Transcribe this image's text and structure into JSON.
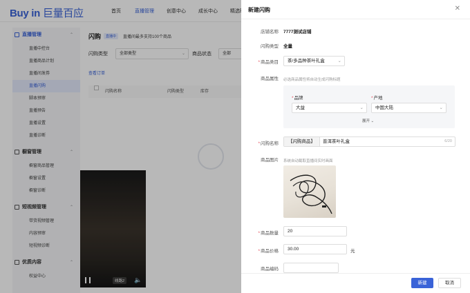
{
  "brand": {
    "logo_latin": "Buy in",
    "logo_cn": "巨量百应"
  },
  "topnav": [
    "首页",
    "直播管理",
    "创意中心",
    "成长中心",
    "精选联盟"
  ],
  "sidebar": {
    "groups": [
      {
        "label": "直播管理",
        "chevron": "⌃",
        "items": [
          "直播中控台",
          "直播商品计划",
          "直播间发券",
          "直播闪购",
          "脚本预审",
          "直播预告",
          "直播设置",
          "直播诊断"
        ]
      },
      {
        "label": "橱窗管理",
        "chevron": "⌃",
        "items": [
          "橱窗商品管理",
          "橱窗设置",
          "橱窗诊断"
        ]
      },
      {
        "label": "短视频管理",
        "chevron": "⌃",
        "items": [
          "带货视频管理",
          "内容预审",
          "短视频诊断"
        ]
      },
      {
        "label": "优质内容",
        "chevron": "⌃",
        "items": [
          "权益中心"
        ]
      }
    ]
  },
  "page": {
    "title": "闪购",
    "badge": "直播中",
    "tip": "直播间最多支持100个商品",
    "filter_type_label": "闪购类型",
    "filter_type_value": "全部类型",
    "filter_status_label": "商品状态",
    "filter_status_value": "全部",
    "orders_link": "查看订单",
    "columns": [
      "闪购名称",
      "闪购类型",
      "库存"
    ]
  },
  "video": {
    "line_label": "线路2"
  },
  "drawer": {
    "title": "新建闪购",
    "shop_label": "店铺名称",
    "shop_value": "7777测试店铺",
    "type_label": "闪购类型",
    "type_value": "全量",
    "category_label": "商品类目",
    "category_value": "茶/多品种茶叶礼盒",
    "attr_label": "商品属性",
    "attr_hint": "必选商品属性将自动生成闪购标题",
    "brand_label": "品牌",
    "brand_value": "大益",
    "origin_label": "产地",
    "origin_value": "中国大陆",
    "expand_label": "展开",
    "name_label": "闪购名称",
    "name_prefix": "【闪购商品】",
    "name_value": "普洱茶叶礼盒",
    "name_counter": "6/20",
    "image_label": "商品图片",
    "image_hint": "系统自动截取直播间实时画面",
    "qty_label": "商品数量",
    "qty_value": "20",
    "price_label": "商品价格",
    "price_value": "30.00",
    "price_unit": "元",
    "code_label": "商品编码",
    "code_value": "",
    "submit_label": "新建",
    "cancel_label": "取消"
  },
  "colors": {
    "accent": "#3a63d8",
    "required": "#e34d59",
    "overlay": "rgba(0,0,0,0.28)"
  }
}
